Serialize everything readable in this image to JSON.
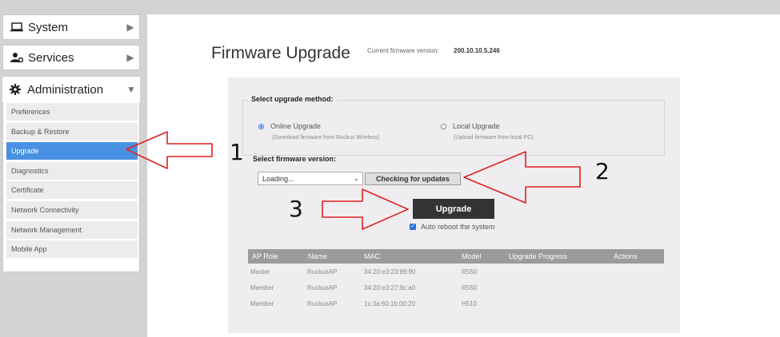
{
  "sidebar": {
    "system_label": "System",
    "services_label": "Services",
    "administration_label": "Administration",
    "items": [
      {
        "label": "Preferences"
      },
      {
        "label": "Backup & Restore"
      },
      {
        "label": "Upgrade"
      },
      {
        "label": "Diagnostics"
      },
      {
        "label": "Certificate"
      },
      {
        "label": "Network Connectivity"
      },
      {
        "label": "Network Management"
      },
      {
        "label": "Mobile App"
      }
    ],
    "active_item": "Upgrade"
  },
  "header": {
    "title": "Firmware Upgrade",
    "firmware_label": "Current firmware version:",
    "firmware_version": "200.10.10.5.246"
  },
  "upgrade_method": {
    "legend": "Select upgrade method:",
    "online_label": "Online Upgrade",
    "online_sub": "(Download firmware from Ruckus Wireless)",
    "local_label": "Local Upgrade",
    "local_sub": "(Upload firmware from local PC)",
    "selected": "Online Upgrade"
  },
  "firmware_select": {
    "label": "Select firmware version:",
    "value": "Loading...",
    "check_button": "Checking for updates"
  },
  "actions": {
    "upgrade_button": "Upgrade",
    "auto_reboot_label": "Auto reboot the system",
    "auto_reboot_checked": true
  },
  "table": {
    "headers": [
      "AP Role",
      "Name",
      "MAC",
      "Model",
      "Upgrade Progress",
      "Actions"
    ],
    "rows": [
      [
        "Master",
        "RuckusAP",
        "34:20:e3:23:99:90",
        "R550"
      ],
      [
        "Member",
        "RuckusAP",
        "34:20:e3:27:9c:a0",
        "R550"
      ],
      [
        "Member",
        "RuckusAP",
        "1c:3a:60:1b:00:20",
        "H510"
      ]
    ]
  },
  "annotations": {
    "step1": "1",
    "step2": "2",
    "step3": "3"
  },
  "colors": {
    "accent_blue": "#4a90e2",
    "arrow_red": "#e02020",
    "upgrade_button_bg": "#333333"
  }
}
